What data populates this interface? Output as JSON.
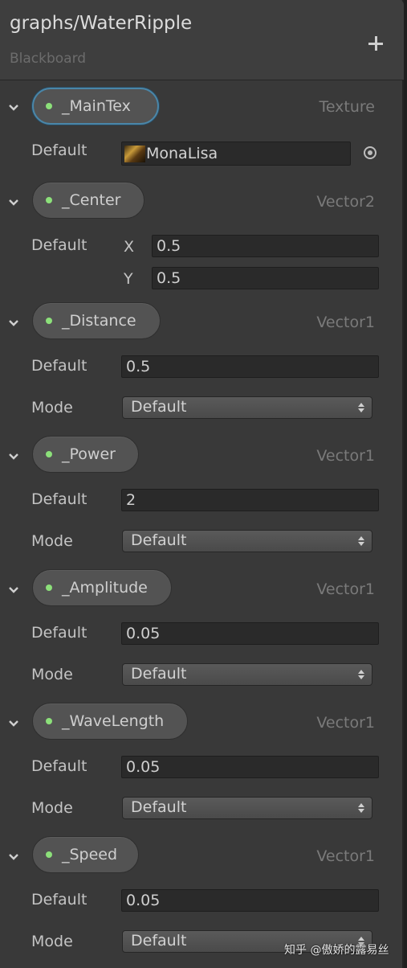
{
  "header": {
    "title": "graphs/WaterRipple",
    "subtitle": "Blackboard",
    "add_icon": "plus-icon"
  },
  "colors": {
    "panel_bg": "#393939",
    "pill_bg": "#535353",
    "dot": "#8ce07a",
    "selected_outline": "#4a86a8"
  },
  "properties": [
    {
      "name": "_MainTex",
      "type": "Texture",
      "selected": true,
      "default_label": "Default",
      "texture": "MonaLisa"
    },
    {
      "name": "_Center",
      "type": "Vector2",
      "default_label": "Default",
      "x_label": "X",
      "x": "0.5",
      "y_label": "Y",
      "y": "0.5"
    },
    {
      "name": "_Distance",
      "type": "Vector1",
      "default_label": "Default",
      "value": "0.5",
      "mode_label": "Mode",
      "mode": "Default"
    },
    {
      "name": "_Power",
      "type": "Vector1",
      "default_label": "Default",
      "value": "2",
      "mode_label": "Mode",
      "mode": "Default"
    },
    {
      "name": "_Amplitude",
      "type": "Vector1",
      "default_label": "Default",
      "value": "0.05",
      "mode_label": "Mode",
      "mode": "Default"
    },
    {
      "name": "_WaveLength",
      "type": "Vector1",
      "default_label": "Default",
      "value": "0.05",
      "mode_label": "Mode",
      "mode": "Default"
    },
    {
      "name": "_Speed",
      "type": "Vector1",
      "default_label": "Default",
      "value": "0.05",
      "mode_label": "Mode",
      "mode": "Default"
    }
  ],
  "watermark": "知乎 @傲娇的露易丝"
}
